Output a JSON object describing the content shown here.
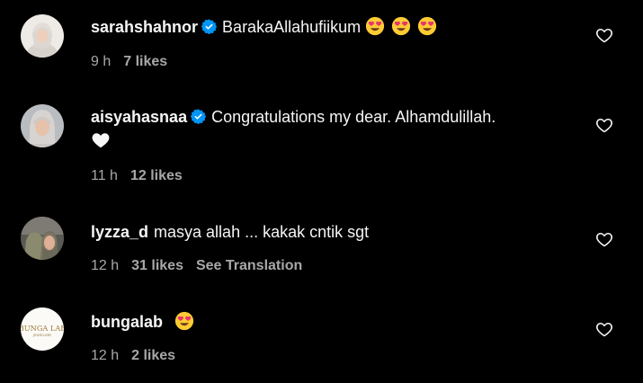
{
  "colors": {
    "background": "#000000",
    "text": "#f5f5f5",
    "meta": "#a8a8a8",
    "verified": "#0095f6"
  },
  "comments": [
    {
      "username": "sarahshahnor",
      "verified": true,
      "text": "BarakaAllahufiikum",
      "emojis": [
        "heart-eyes-emoji",
        "heart-eyes-emoji",
        "heart-eyes-emoji"
      ],
      "time": "9 h",
      "likes": "7 likes"
    },
    {
      "username": "aisyahasnaa",
      "verified": true,
      "text": "Congratulations my dear. Alhamdulillah.",
      "emojis": [
        "white-heart-emoji"
      ],
      "time": "11 h",
      "likes": "12 likes"
    },
    {
      "username": "lyzza_d",
      "verified": false,
      "text": "masya allah ... kakak cntik sgt",
      "emojis": [],
      "time": "12 h",
      "likes": "31 likes",
      "translation_label": "See Translation"
    },
    {
      "username": "bungalab",
      "verified": false,
      "text": "",
      "emojis": [
        "heart-eyes-emoji"
      ],
      "time": "12 h",
      "likes": "2 likes",
      "avatar_logo_text": "BUNGA LAB",
      "avatar_logo_subtext": "JEWELLERY"
    }
  ]
}
